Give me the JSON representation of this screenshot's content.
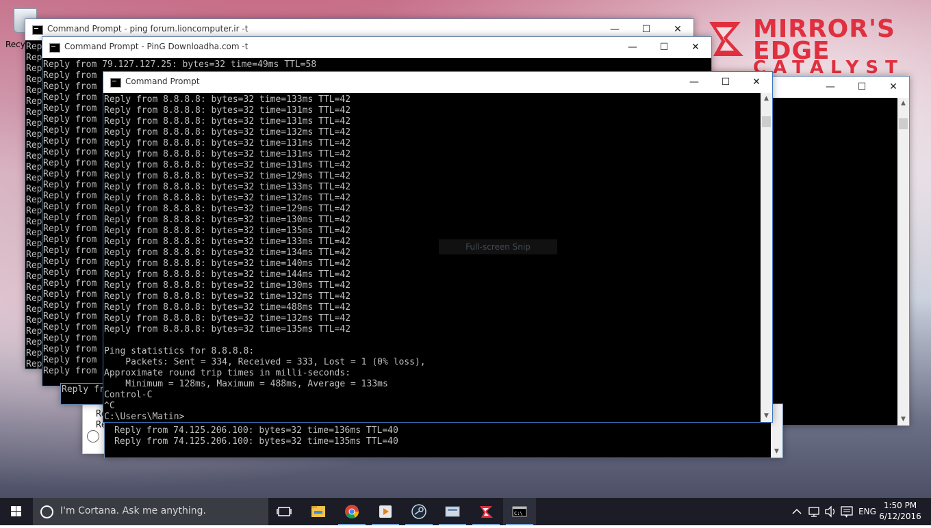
{
  "desktop": {
    "recycle_bin_label": "Recyc",
    "wallpaper": {
      "title_line1": "MIRROR'S",
      "title_line2": "EDGE",
      "title_line3": "CATALYST",
      "accent": "#e0303f"
    }
  },
  "windows": {
    "w1": {
      "title": "Command Prompt - ping  forum.lioncomputer.ir -t",
      "lines": [
        "Rep",
        "Rep",
        "Rep",
        "Rep",
        "Rep",
        "Rep",
        "Rep",
        "Rep",
        "Rep",
        "Rep",
        "Rep",
        "Rep",
        "Rep",
        "Rep",
        "Rep",
        "Rep",
        "Rep",
        "Rep",
        "Rep",
        "Rep",
        "Rep",
        "Rep",
        "Rep",
        "Rep",
        "Rep",
        "Rep",
        "Rep",
        "Rep",
        "Rep",
        "Rep"
      ]
    },
    "w2": {
      "title": "Command Prompt - PinG  Downloadha.com -t",
      "first_line": "Reply from 79.127.127.25: bytes=32 time=49ms TTL=58",
      "line_prefix": "Reply from"
    },
    "w3": {
      "title": "Command Prompt",
      "lines": [
        "Reply from 8.8.8.8: bytes=32 time=133ms TTL=42",
        "Reply from 8.8.8.8: bytes=32 time=131ms TTL=42",
        "Reply from 8.8.8.8: bytes=32 time=131ms TTL=42",
        "Reply from 8.8.8.8: bytes=32 time=132ms TTL=42",
        "Reply from 8.8.8.8: bytes=32 time=131ms TTL=42",
        "Reply from 8.8.8.8: bytes=32 time=131ms TTL=42",
        "Reply from 8.8.8.8: bytes=32 time=131ms TTL=42",
        "Reply from 8.8.8.8: bytes=32 time=129ms TTL=42",
        "Reply from 8.8.8.8: bytes=32 time=133ms TTL=42",
        "Reply from 8.8.8.8: bytes=32 time=132ms TTL=42",
        "Reply from 8.8.8.8: bytes=32 time=129ms TTL=42",
        "Reply from 8.8.8.8: bytes=32 time=130ms TTL=42",
        "Reply from 8.8.8.8: bytes=32 time=135ms TTL=42",
        "Reply from 8.8.8.8: bytes=32 time=133ms TTL=42",
        "Reply from 8.8.8.8: bytes=32 time=134ms TTL=42",
        "Reply from 8.8.8.8: bytes=32 time=140ms TTL=42",
        "Reply from 8.8.8.8: bytes=32 time=144ms TTL=42",
        "Reply from 8.8.8.8: bytes=32 time=130ms TTL=42",
        "Reply from 8.8.8.8: bytes=32 time=132ms TTL=42",
        "Reply from 8.8.8.8: bytes=32 time=488ms TTL=42",
        "Reply from 8.8.8.8: bytes=32 time=132ms TTL=42",
        "Reply from 8.8.8.8: bytes=32 time=135ms TTL=42",
        "",
        "Ping statistics for 8.8.8.8:",
        "    Packets: Sent = 334, Received = 333, Lost = 1 (0% loss),",
        "Approximate round trip times in milli-seconds:",
        "    Minimum = 128ms, Maximum = 488ms, Average = 133ms",
        "Control-C",
        "^C",
        "C:\\Users\\Matin>"
      ]
    },
    "w4": {
      "lines": [
        "Reply from 74.125.206.100: bytes=32 time=136ms TTL=40",
        "Reply from 74.125.206.100: bytes=32 time=135ms TTL=40"
      ]
    },
    "w6": {
      "lines": [
        "Re",
        "Rep"
      ]
    }
  },
  "snip_label": "Full-screen Snip",
  "taskbar": {
    "cortana_placeholder": "I'm Cortana. Ask me anything.",
    "language": "ENG",
    "time": "1:50 PM",
    "date": "6/12/2016"
  },
  "icons": {
    "start": "windows-logo-icon",
    "task_view": "task-view-icon",
    "explorer": "folder-icon",
    "chrome": "chrome-icon",
    "media": "media-player-icon",
    "steam": "steam-icon",
    "network_tool": "network-tool-icon",
    "mirrors_edge": "mirrors-edge-icon",
    "cmd": "command-prompt-icon"
  }
}
